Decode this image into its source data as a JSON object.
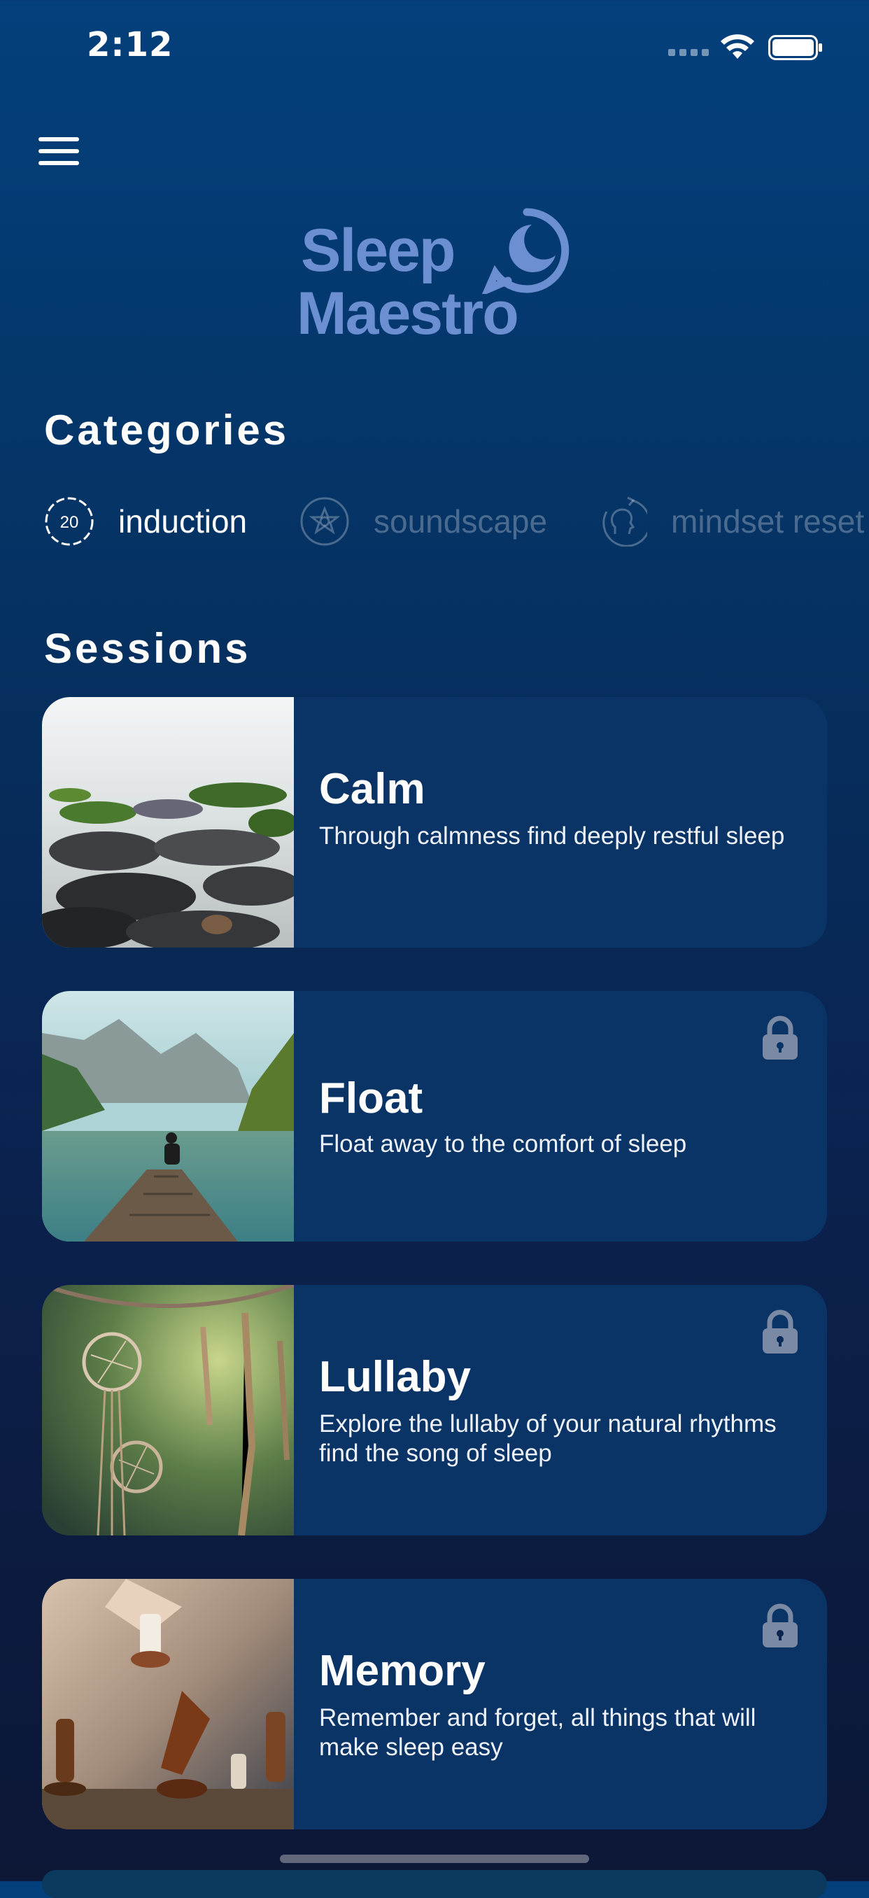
{
  "status_bar": {
    "time": "2:12"
  },
  "header": {
    "logo_line1": "Sleep",
    "logo_line2": "Maestro"
  },
  "categories": {
    "title": "Categories",
    "items": [
      {
        "label": "induction",
        "icon": "timer-20-icon",
        "icon_text": "20",
        "active": true
      },
      {
        "label": "soundscape",
        "icon": "flower-icon",
        "active": false
      },
      {
        "label": "mindset reset",
        "icon": "head-refresh-icon",
        "active": false
      }
    ]
  },
  "sessions": {
    "title": "Sessions",
    "items": [
      {
        "title": "Calm",
        "description": "Through calmness find deeply restful sleep",
        "locked": false,
        "image": "misty-rocks-shore"
      },
      {
        "title": "Float",
        "description": "Float away to the comfort of sleep",
        "locked": true,
        "image": "person-on-lake-pier"
      },
      {
        "title": "Lullaby",
        "description": "Explore the lullaby of your natural rhythms find the song of sleep",
        "locked": true,
        "image": "dreamcatchers"
      },
      {
        "title": "Memory",
        "description": "Remember and forget, all things that will make sleep easy",
        "locked": true,
        "image": "chess-pieces"
      }
    ]
  },
  "colors": {
    "logo": "#6b8fd1",
    "card_bg": "#0a3366",
    "background_top": "#04407c",
    "background_bottom": "#0d1736"
  }
}
